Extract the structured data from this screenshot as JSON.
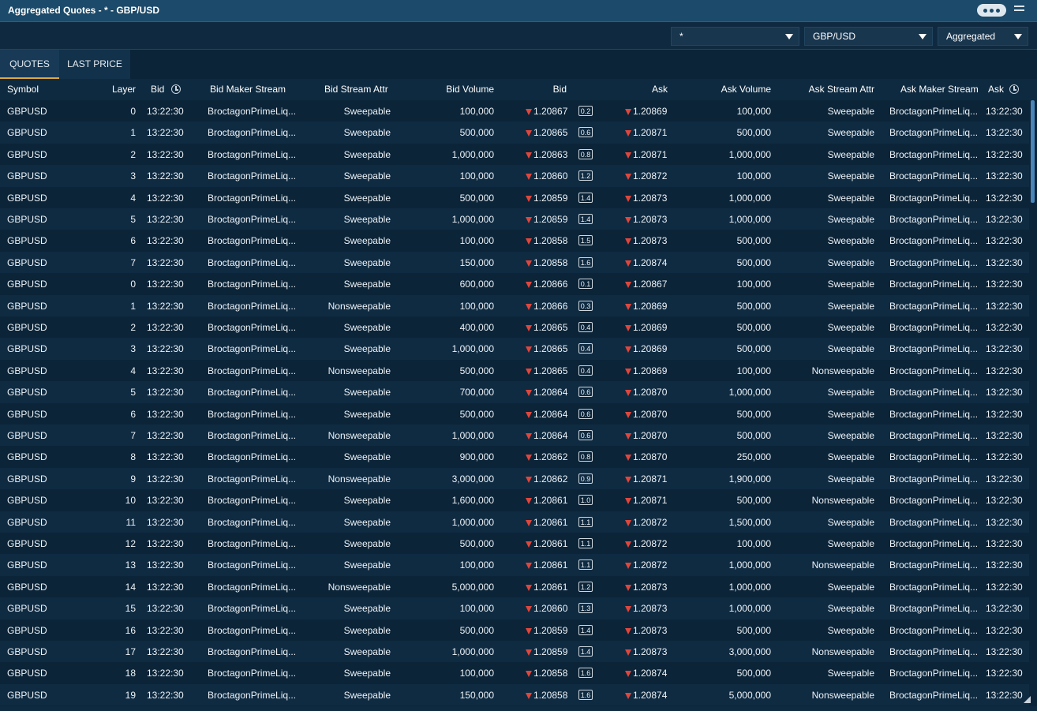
{
  "window": {
    "title": "Aggregated Quotes - * - GBP/USD"
  },
  "filters": {
    "stream": "*",
    "symbol": "GBP/USD",
    "mode": "Aggregated"
  },
  "tabs": [
    {
      "label": "QUOTES",
      "active": true
    },
    {
      "label": "LAST PRICE",
      "active": false
    }
  ],
  "columns": {
    "symbol": "Symbol",
    "layer": "Layer",
    "bid_time": "Bid",
    "bid_maker": "Bid Maker Stream",
    "bid_attr": "Bid Stream Attr",
    "bid_volume": "Bid Volume",
    "bid": "Bid",
    "ask": "Ask",
    "ask_volume": "Ask Volume",
    "ask_attr": "Ask Stream Attr",
    "ask_maker": "Ask Maker Stream",
    "ask_time": "Ask"
  },
  "colors": {
    "down_arrow": "#e0463c",
    "active_tab_underline": "#e0a93a"
  },
  "rows": [
    {
      "symbol": "GBPUSD",
      "layer": "0",
      "bid_time": "13:22:30",
      "bid_maker": "BroctagonPrimeLiq...",
      "bid_attr": "Sweepable",
      "bid_volume": "100,000",
      "bid": "1.20867",
      "spread": "0.2",
      "ask": "1.20869",
      "ask_volume": "100,000",
      "ask_attr": "Sweepable",
      "ask_maker": "BroctagonPrimeLiq...",
      "ask_time": "13:22:30"
    },
    {
      "symbol": "GBPUSD",
      "layer": "1",
      "bid_time": "13:22:30",
      "bid_maker": "BroctagonPrimeLiq...",
      "bid_attr": "Sweepable",
      "bid_volume": "500,000",
      "bid": "1.20865",
      "spread": "0.6",
      "ask": "1.20871",
      "ask_volume": "500,000",
      "ask_attr": "Sweepable",
      "ask_maker": "BroctagonPrimeLiq...",
      "ask_time": "13:22:30"
    },
    {
      "symbol": "GBPUSD",
      "layer": "2",
      "bid_time": "13:22:30",
      "bid_maker": "BroctagonPrimeLiq...",
      "bid_attr": "Sweepable",
      "bid_volume": "1,000,000",
      "bid": "1.20863",
      "spread": "0.8",
      "ask": "1.20871",
      "ask_volume": "1,000,000",
      "ask_attr": "Sweepable",
      "ask_maker": "BroctagonPrimeLiq...",
      "ask_time": "13:22:30"
    },
    {
      "symbol": "GBPUSD",
      "layer": "3",
      "bid_time": "13:22:30",
      "bid_maker": "BroctagonPrimeLiq...",
      "bid_attr": "Sweepable",
      "bid_volume": "100,000",
      "bid": "1.20860",
      "spread": "1.2",
      "ask": "1.20872",
      "ask_volume": "100,000",
      "ask_attr": "Sweepable",
      "ask_maker": "BroctagonPrimeLiq...",
      "ask_time": "13:22:30"
    },
    {
      "symbol": "GBPUSD",
      "layer": "4",
      "bid_time": "13:22:30",
      "bid_maker": "BroctagonPrimeLiq...",
      "bid_attr": "Sweepable",
      "bid_volume": "500,000",
      "bid": "1.20859",
      "spread": "1.4",
      "ask": "1.20873",
      "ask_volume": "1,000,000",
      "ask_attr": "Sweepable",
      "ask_maker": "BroctagonPrimeLiq...",
      "ask_time": "13:22:30"
    },
    {
      "symbol": "GBPUSD",
      "layer": "5",
      "bid_time": "13:22:30",
      "bid_maker": "BroctagonPrimeLiq...",
      "bid_attr": "Sweepable",
      "bid_volume": "1,000,000",
      "bid": "1.20859",
      "spread": "1.4",
      "ask": "1.20873",
      "ask_volume": "1,000,000",
      "ask_attr": "Sweepable",
      "ask_maker": "BroctagonPrimeLiq...",
      "ask_time": "13:22:30"
    },
    {
      "symbol": "GBPUSD",
      "layer": "6",
      "bid_time": "13:22:30",
      "bid_maker": "BroctagonPrimeLiq...",
      "bid_attr": "Sweepable",
      "bid_volume": "100,000",
      "bid": "1.20858",
      "spread": "1.5",
      "ask": "1.20873",
      "ask_volume": "500,000",
      "ask_attr": "Sweepable",
      "ask_maker": "BroctagonPrimeLiq...",
      "ask_time": "13:22:30"
    },
    {
      "symbol": "GBPUSD",
      "layer": "7",
      "bid_time": "13:22:30",
      "bid_maker": "BroctagonPrimeLiq...",
      "bid_attr": "Sweepable",
      "bid_volume": "150,000",
      "bid": "1.20858",
      "spread": "1.6",
      "ask": "1.20874",
      "ask_volume": "500,000",
      "ask_attr": "Sweepable",
      "ask_maker": "BroctagonPrimeLiq...",
      "ask_time": "13:22:30"
    },
    {
      "symbol": "GBPUSD",
      "layer": "0",
      "bid_time": "13:22:30",
      "bid_maker": "BroctagonPrimeLiq...",
      "bid_attr": "Sweepable",
      "bid_volume": "600,000",
      "bid": "1.20866",
      "spread": "0.1",
      "ask": "1.20867",
      "ask_volume": "100,000",
      "ask_attr": "Sweepable",
      "ask_maker": "BroctagonPrimeLiq...",
      "ask_time": "13:22:30"
    },
    {
      "symbol": "GBPUSD",
      "layer": "1",
      "bid_time": "13:22:30",
      "bid_maker": "BroctagonPrimeLiq...",
      "bid_attr": "Nonsweepable",
      "bid_volume": "100,000",
      "bid": "1.20866",
      "spread": "0.3",
      "ask": "1.20869",
      "ask_volume": "500,000",
      "ask_attr": "Sweepable",
      "ask_maker": "BroctagonPrimeLiq...",
      "ask_time": "13:22:30"
    },
    {
      "symbol": "GBPUSD",
      "layer": "2",
      "bid_time": "13:22:30",
      "bid_maker": "BroctagonPrimeLiq...",
      "bid_attr": "Sweepable",
      "bid_volume": "400,000",
      "bid": "1.20865",
      "spread": "0.4",
      "ask": "1.20869",
      "ask_volume": "500,000",
      "ask_attr": "Sweepable",
      "ask_maker": "BroctagonPrimeLiq...",
      "ask_time": "13:22:30"
    },
    {
      "symbol": "GBPUSD",
      "layer": "3",
      "bid_time": "13:22:30",
      "bid_maker": "BroctagonPrimeLiq...",
      "bid_attr": "Sweepable",
      "bid_volume": "1,000,000",
      "bid": "1.20865",
      "spread": "0.4",
      "ask": "1.20869",
      "ask_volume": "500,000",
      "ask_attr": "Sweepable",
      "ask_maker": "BroctagonPrimeLiq...",
      "ask_time": "13:22:30"
    },
    {
      "symbol": "GBPUSD",
      "layer": "4",
      "bid_time": "13:22:30",
      "bid_maker": "BroctagonPrimeLiq...",
      "bid_attr": "Nonsweepable",
      "bid_volume": "500,000",
      "bid": "1.20865",
      "spread": "0.4",
      "ask": "1.20869",
      "ask_volume": "100,000",
      "ask_attr": "Nonsweepable",
      "ask_maker": "BroctagonPrimeLiq...",
      "ask_time": "13:22:30"
    },
    {
      "symbol": "GBPUSD",
      "layer": "5",
      "bid_time": "13:22:30",
      "bid_maker": "BroctagonPrimeLiq...",
      "bid_attr": "Sweepable",
      "bid_volume": "700,000",
      "bid": "1.20864",
      "spread": "0.6",
      "ask": "1.20870",
      "ask_volume": "1,000,000",
      "ask_attr": "Sweepable",
      "ask_maker": "BroctagonPrimeLiq...",
      "ask_time": "13:22:30"
    },
    {
      "symbol": "GBPUSD",
      "layer": "6",
      "bid_time": "13:22:30",
      "bid_maker": "BroctagonPrimeLiq...",
      "bid_attr": "Sweepable",
      "bid_volume": "500,000",
      "bid": "1.20864",
      "spread": "0.6",
      "ask": "1.20870",
      "ask_volume": "500,000",
      "ask_attr": "Sweepable",
      "ask_maker": "BroctagonPrimeLiq...",
      "ask_time": "13:22:30"
    },
    {
      "symbol": "GBPUSD",
      "layer": "7",
      "bid_time": "13:22:30",
      "bid_maker": "BroctagonPrimeLiq...",
      "bid_attr": "Nonsweepable",
      "bid_volume": "1,000,000",
      "bid": "1.20864",
      "spread": "0.6",
      "ask": "1.20870",
      "ask_volume": "500,000",
      "ask_attr": "Sweepable",
      "ask_maker": "BroctagonPrimeLiq...",
      "ask_time": "13:22:30"
    },
    {
      "symbol": "GBPUSD",
      "layer": "8",
      "bid_time": "13:22:30",
      "bid_maker": "BroctagonPrimeLiq...",
      "bid_attr": "Sweepable",
      "bid_volume": "900,000",
      "bid": "1.20862",
      "spread": "0.8",
      "ask": "1.20870",
      "ask_volume": "250,000",
      "ask_attr": "Sweepable",
      "ask_maker": "BroctagonPrimeLiq...",
      "ask_time": "13:22:30"
    },
    {
      "symbol": "GBPUSD",
      "layer": "9",
      "bid_time": "13:22:30",
      "bid_maker": "BroctagonPrimeLiq...",
      "bid_attr": "Nonsweepable",
      "bid_volume": "3,000,000",
      "bid": "1.20862",
      "spread": "0.9",
      "ask": "1.20871",
      "ask_volume": "1,900,000",
      "ask_attr": "Sweepable",
      "ask_maker": "BroctagonPrimeLiq...",
      "ask_time": "13:22:30"
    },
    {
      "symbol": "GBPUSD",
      "layer": "10",
      "bid_time": "13:22:30",
      "bid_maker": "BroctagonPrimeLiq...",
      "bid_attr": "Sweepable",
      "bid_volume": "1,600,000",
      "bid": "1.20861",
      "spread": "1.0",
      "ask": "1.20871",
      "ask_volume": "500,000",
      "ask_attr": "Nonsweepable",
      "ask_maker": "BroctagonPrimeLiq...",
      "ask_time": "13:22:30"
    },
    {
      "symbol": "GBPUSD",
      "layer": "11",
      "bid_time": "13:22:30",
      "bid_maker": "BroctagonPrimeLiq...",
      "bid_attr": "Sweepable",
      "bid_volume": "1,000,000",
      "bid": "1.20861",
      "spread": "1.1",
      "ask": "1.20872",
      "ask_volume": "1,500,000",
      "ask_attr": "Sweepable",
      "ask_maker": "BroctagonPrimeLiq...",
      "ask_time": "13:22:30"
    },
    {
      "symbol": "GBPUSD",
      "layer": "12",
      "bid_time": "13:22:30",
      "bid_maker": "BroctagonPrimeLiq...",
      "bid_attr": "Sweepable",
      "bid_volume": "500,000",
      "bid": "1.20861",
      "spread": "1.1",
      "ask": "1.20872",
      "ask_volume": "100,000",
      "ask_attr": "Sweepable",
      "ask_maker": "BroctagonPrimeLiq...",
      "ask_time": "13:22:30"
    },
    {
      "symbol": "GBPUSD",
      "layer": "13",
      "bid_time": "13:22:30",
      "bid_maker": "BroctagonPrimeLiq...",
      "bid_attr": "Sweepable",
      "bid_volume": "100,000",
      "bid": "1.20861",
      "spread": "1.1",
      "ask": "1.20872",
      "ask_volume": "1,000,000",
      "ask_attr": "Nonsweepable",
      "ask_maker": "BroctagonPrimeLiq...",
      "ask_time": "13:22:30"
    },
    {
      "symbol": "GBPUSD",
      "layer": "14",
      "bid_time": "13:22:30",
      "bid_maker": "BroctagonPrimeLiq...",
      "bid_attr": "Nonsweepable",
      "bid_volume": "5,000,000",
      "bid": "1.20861",
      "spread": "1.2",
      "ask": "1.20873",
      "ask_volume": "1,000,000",
      "ask_attr": "Sweepable",
      "ask_maker": "BroctagonPrimeLiq...",
      "ask_time": "13:22:30"
    },
    {
      "symbol": "GBPUSD",
      "layer": "15",
      "bid_time": "13:22:30",
      "bid_maker": "BroctagonPrimeLiq...",
      "bid_attr": "Sweepable",
      "bid_volume": "100,000",
      "bid": "1.20860",
      "spread": "1.3",
      "ask": "1.20873",
      "ask_volume": "1,000,000",
      "ask_attr": "Sweepable",
      "ask_maker": "BroctagonPrimeLiq...",
      "ask_time": "13:22:30"
    },
    {
      "symbol": "GBPUSD",
      "layer": "16",
      "bid_time": "13:22:30",
      "bid_maker": "BroctagonPrimeLiq...",
      "bid_attr": "Sweepable",
      "bid_volume": "500,000",
      "bid": "1.20859",
      "spread": "1.4",
      "ask": "1.20873",
      "ask_volume": "500,000",
      "ask_attr": "Sweepable",
      "ask_maker": "BroctagonPrimeLiq...",
      "ask_time": "13:22:30"
    },
    {
      "symbol": "GBPUSD",
      "layer": "17",
      "bid_time": "13:22:30",
      "bid_maker": "BroctagonPrimeLiq...",
      "bid_attr": "Sweepable",
      "bid_volume": "1,000,000",
      "bid": "1.20859",
      "spread": "1.4",
      "ask": "1.20873",
      "ask_volume": "3,000,000",
      "ask_attr": "Nonsweepable",
      "ask_maker": "BroctagonPrimeLiq...",
      "ask_time": "13:22:30"
    },
    {
      "symbol": "GBPUSD",
      "layer": "18",
      "bid_time": "13:22:30",
      "bid_maker": "BroctagonPrimeLiq...",
      "bid_attr": "Sweepable",
      "bid_volume": "100,000",
      "bid": "1.20858",
      "spread": "1.6",
      "ask": "1.20874",
      "ask_volume": "500,000",
      "ask_attr": "Sweepable",
      "ask_maker": "BroctagonPrimeLiq...",
      "ask_time": "13:22:30"
    },
    {
      "symbol": "GBPUSD",
      "layer": "19",
      "bid_time": "13:22:30",
      "bid_maker": "BroctagonPrimeLiq...",
      "bid_attr": "Sweepable",
      "bid_volume": "150,000",
      "bid": "1.20858",
      "spread": "1.6",
      "ask": "1.20874",
      "ask_volume": "5,000,000",
      "ask_attr": "Nonsweepable",
      "ask_maker": "BroctagonPrimeLiq...",
      "ask_time": "13:22:30"
    }
  ]
}
